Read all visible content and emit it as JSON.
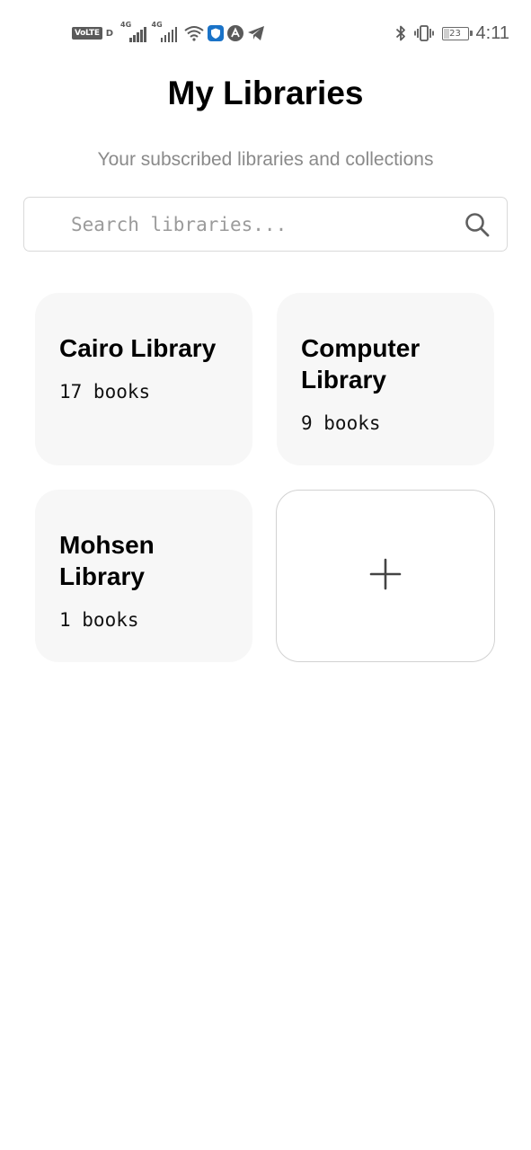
{
  "status_bar": {
    "time": "4:11",
    "battery_level": "23",
    "volte_label": "VoLTE",
    "sim_label": "D",
    "network_label": "4G",
    "icons": [
      "volte-icon",
      "signal-icon",
      "signal-icon",
      "wifi-icon",
      "shield-app-icon",
      "android-app-icon",
      "telegram-icon",
      "bluetooth-icon",
      "vibrate-icon",
      "battery-icon"
    ]
  },
  "header": {
    "title": "My Libraries",
    "subtitle": "Your subscribed libraries and collections"
  },
  "search": {
    "placeholder": "Search libraries...",
    "value": ""
  },
  "libraries": [
    {
      "name": "Cairo Library",
      "count": "17 books"
    },
    {
      "name": "Computer Library",
      "count": "9 books"
    },
    {
      "name": "Mohsen Library",
      "count": "1 books"
    }
  ],
  "add_card": {
    "icon": "plus-icon"
  },
  "colors": {
    "background": "#ffffff",
    "card": "#f7f7f7",
    "subtitle": "#8a8a8a",
    "border": "#d9d9d9"
  }
}
